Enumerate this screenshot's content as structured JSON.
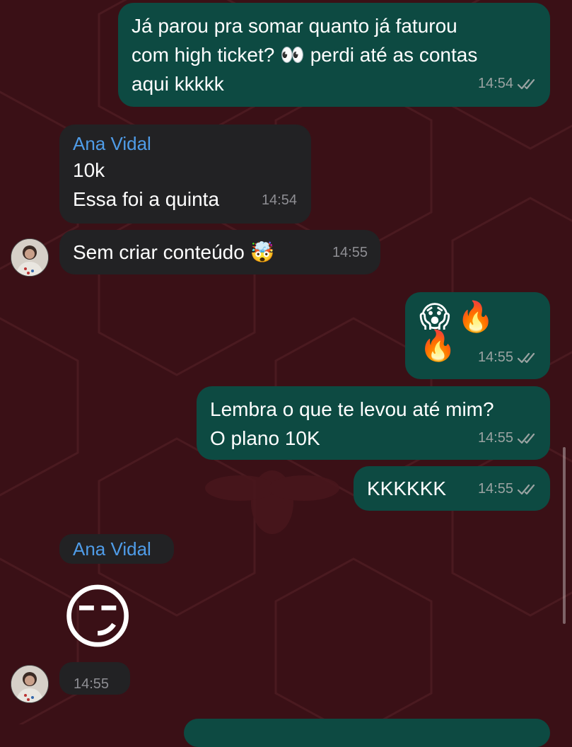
{
  "chat": {
    "messages": [
      {
        "text": "Já parou pra somar quanto já faturou\ncom high ticket? 👀 perdi até as contas\naqui kkkkk",
        "time": "14:54"
      },
      {
        "sender": "Ana Vidal",
        "text": "10k\nEssa foi a quinta",
        "time": "14:54"
      },
      {
        "text": "Sem criar conteúdo 🤯",
        "time": "14:55"
      },
      {
        "text": "😱🔥🔥",
        "time": "14:55"
      },
      {
        "text": "Lembra o que te levou até mim?\nO plano 10K",
        "time": "14:55"
      },
      {
        "text": "KKKKKK",
        "time": "14:55"
      },
      {
        "sender": "Ana Vidal",
        "emoji": "😏",
        "time": "14:55"
      }
    ]
  },
  "icons": {
    "read_receipt": "double-check-icon",
    "avatar": "avatar-photo"
  },
  "colors": {
    "background": "#3a1016",
    "outgoing_bubble": "#0d4a42",
    "incoming_bubble": "#222224",
    "sender_name": "#4f9ce8",
    "timestamp": "#9aa3a2"
  }
}
